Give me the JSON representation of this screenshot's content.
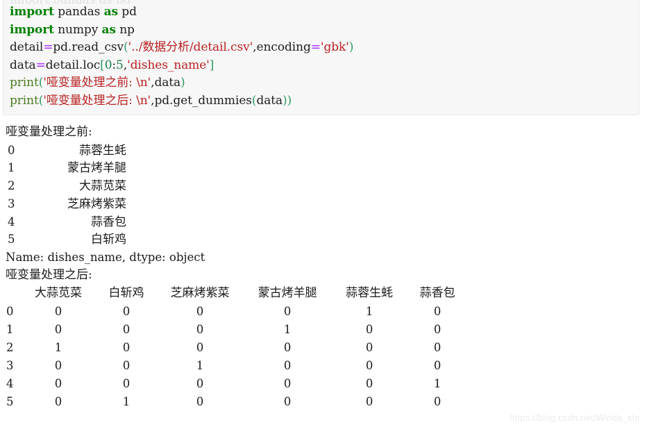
{
  "colors": {
    "page_background": "#ffffff",
    "code_background": "#f7f7f7",
    "code_border": "#e8e8e8",
    "keyword": "#008000",
    "string": "#ba2121",
    "number": "#208050",
    "operator": "#aa22ff",
    "function": "#4a7d20",
    "paren": "#339966",
    "text": "#1a1a1a",
    "watermark": "#ebebeb"
  },
  "code_cell": {
    "ghost_line": "import pandas as pd",
    "lines": [
      {
        "id": "line-1",
        "tokens": [
          {
            "t": "import",
            "c": "kw"
          },
          {
            "t": " pandas ",
            "c": "name"
          },
          {
            "t": "as",
            "c": "kw"
          },
          {
            "t": " pd",
            "c": "name"
          }
        ]
      },
      {
        "id": "line-2",
        "tokens": [
          {
            "t": "import",
            "c": "kw"
          },
          {
            "t": " numpy ",
            "c": "name"
          },
          {
            "t": "as",
            "c": "kw"
          },
          {
            "t": " np",
            "c": "name"
          }
        ]
      },
      {
        "id": "line-3",
        "tokens": [
          {
            "t": "detail",
            "c": "name"
          },
          {
            "t": "=",
            "c": "op"
          },
          {
            "t": "pd.read_csv",
            "c": "name"
          },
          {
            "t": "(",
            "c": "paren"
          },
          {
            "t": "'../数据分析/detail.csv'",
            "c": "str"
          },
          {
            "t": ",",
            "c": "punc"
          },
          {
            "t": "encoding",
            "c": "name"
          },
          {
            "t": "=",
            "c": "op"
          },
          {
            "t": "'gbk'",
            "c": "str"
          },
          {
            "t": ")",
            "c": "paren"
          }
        ]
      },
      {
        "id": "line-4",
        "tokens": [
          {
            "t": "data",
            "c": "name"
          },
          {
            "t": "=",
            "c": "op"
          },
          {
            "t": "detail.loc",
            "c": "name"
          },
          {
            "t": "[",
            "c": "paren"
          },
          {
            "t": "0",
            "c": "num"
          },
          {
            "t": ":",
            "c": "punc"
          },
          {
            "t": "5",
            "c": "num"
          },
          {
            "t": ",",
            "c": "punc"
          },
          {
            "t": "'dishes_name'",
            "c": "str"
          },
          {
            "t": "]",
            "c": "paren"
          }
        ]
      },
      {
        "id": "line-5",
        "tokens": [
          {
            "t": "print",
            "c": "fn"
          },
          {
            "t": "(",
            "c": "paren"
          },
          {
            "t": "'哑变量处理之前: \\n'",
            "c": "str"
          },
          {
            "t": ",",
            "c": "punc"
          },
          {
            "t": "data",
            "c": "name"
          },
          {
            "t": ")",
            "c": "paren"
          }
        ]
      },
      {
        "id": "line-6",
        "tokens": [
          {
            "t": "print",
            "c": "fn"
          },
          {
            "t": "(",
            "c": "paren"
          },
          {
            "t": "'哑变量处理之后: \\n'",
            "c": "str"
          },
          {
            "t": ",",
            "c": "punc"
          },
          {
            "t": "pd.get_dummies",
            "c": "name"
          },
          {
            "t": "(",
            "c": "paren"
          },
          {
            "t": "data",
            "c": "name"
          },
          {
            "t": "))",
            "c": "paren"
          }
        ]
      }
    ]
  },
  "output": {
    "before_label": "哑变量处理之前:",
    "series_rows": [
      {
        "index": "0",
        "value": "蒜蓉生蚝"
      },
      {
        "index": "1",
        "value": "蒙古烤羊腿"
      },
      {
        "index": "2",
        "value": "大蒜苋菜"
      },
      {
        "index": "3",
        "value": "芝麻烤紫菜"
      },
      {
        "index": "4",
        "value": "蒜香包"
      },
      {
        "index": "5",
        "value": "白斩鸡"
      }
    ],
    "series_footer": "Name: dishes_name, dtype: object",
    "after_label": "哑变量处理之后:",
    "dummies_table": {
      "columns": [
        "大蒜苋菜",
        "白斩鸡",
        "芝麻烤紫菜",
        "蒙古烤羊腿",
        "蒜蓉生蚝",
        "蒜香包"
      ],
      "rows": [
        {
          "index": "0",
          "values": [
            "0",
            "0",
            "0",
            "0",
            "1",
            "0"
          ]
        },
        {
          "index": "1",
          "values": [
            "0",
            "0",
            "0",
            "1",
            "0",
            "0"
          ]
        },
        {
          "index": "2",
          "values": [
            "1",
            "0",
            "0",
            "0",
            "0",
            "0"
          ]
        },
        {
          "index": "3",
          "values": [
            "0",
            "0",
            "1",
            "0",
            "0",
            "0"
          ]
        },
        {
          "index": "4",
          "values": [
            "0",
            "0",
            "0",
            "0",
            "0",
            "1"
          ]
        },
        {
          "index": "5",
          "values": [
            "0",
            "1",
            "0",
            "0",
            "0",
            "0"
          ]
        }
      ]
    }
  },
  "watermark": {
    "text": "https://blog.csdn.net/Winda_shi"
  }
}
